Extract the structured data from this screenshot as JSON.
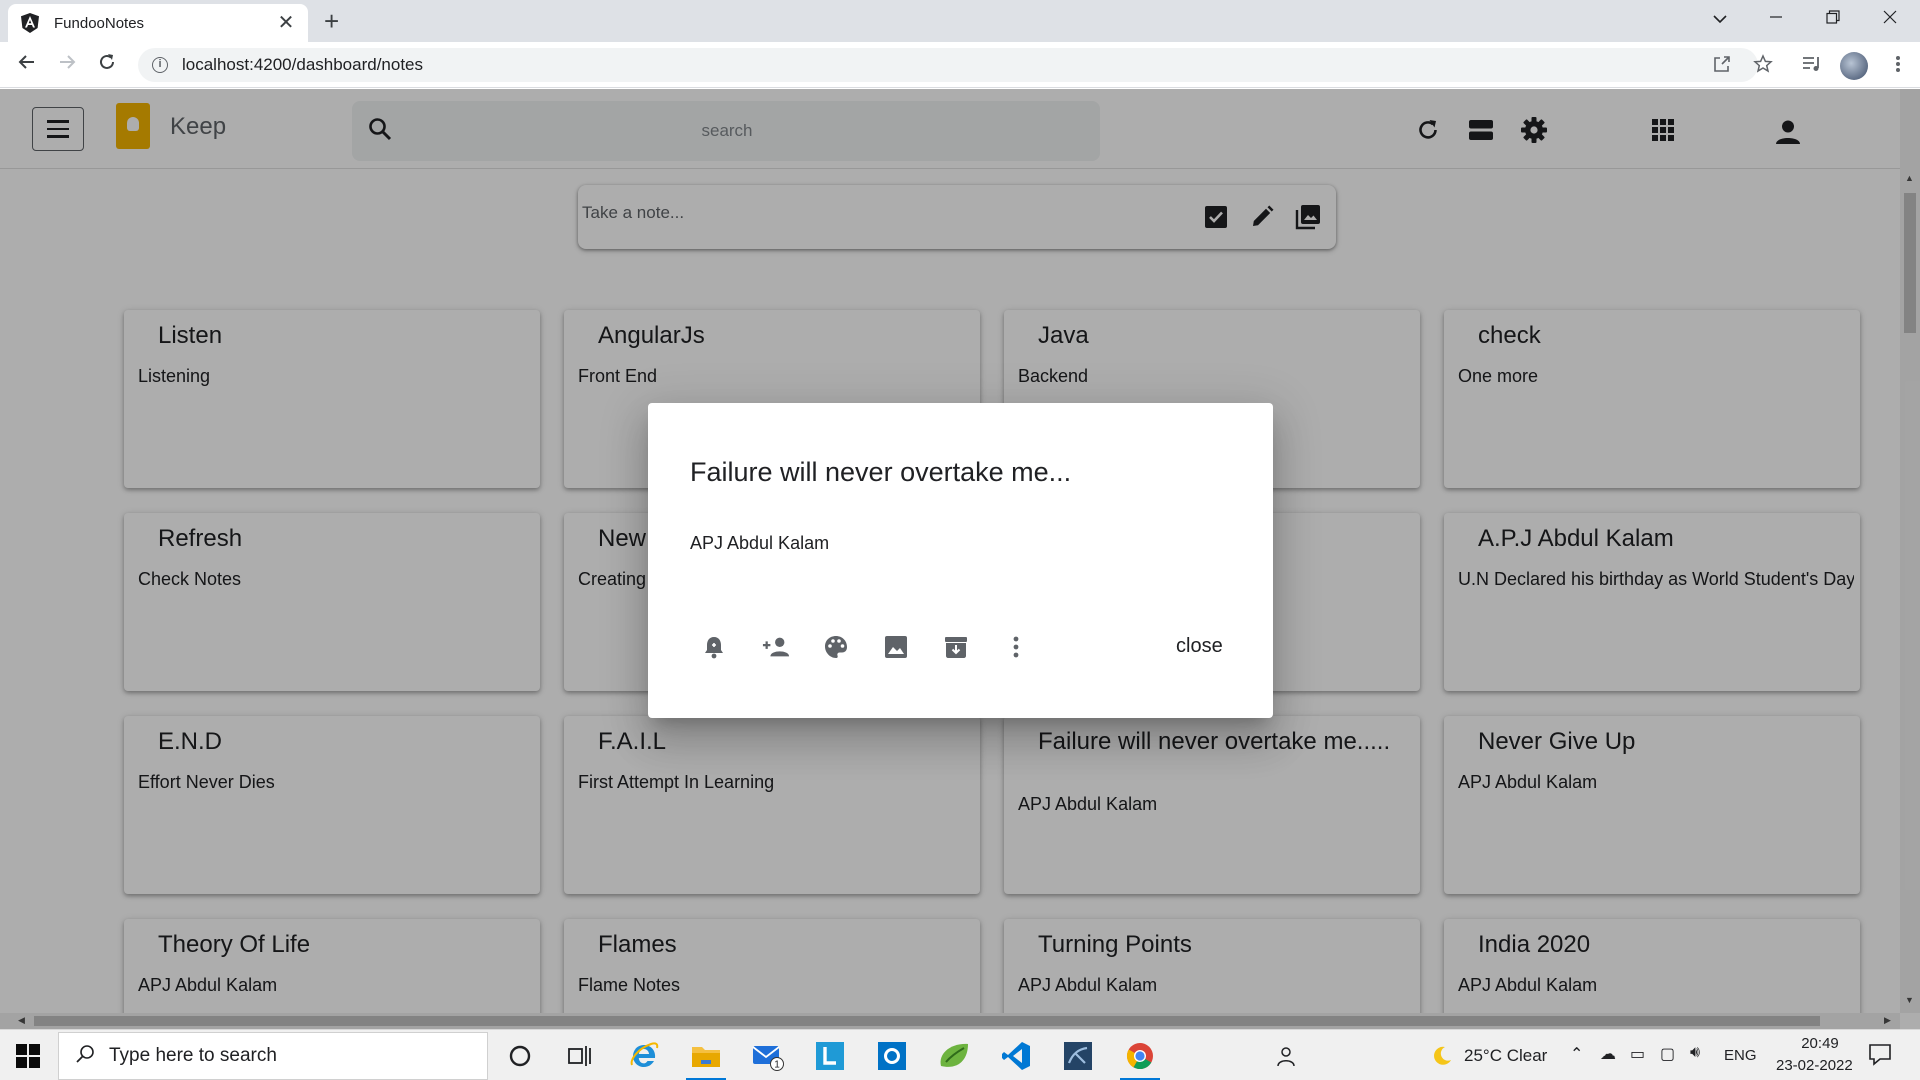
{
  "browser": {
    "tab_title": "FundooNotes",
    "tab_close": "✕",
    "new_tab": "+",
    "url": "localhost:4200/dashboard/notes",
    "info": "i"
  },
  "app": {
    "title": "Keep",
    "search_placeholder": "search",
    "note_placeholder": "Take a note..."
  },
  "notes": [
    {
      "title": "Listen",
      "description": "Listening"
    },
    {
      "title": "AngularJs",
      "description": "Front End"
    },
    {
      "title": "Java",
      "description": "Backend"
    },
    {
      "title": "check",
      "description": "One more"
    },
    {
      "title": "Refresh",
      "description": "Check Notes"
    },
    {
      "title": "New",
      "description": "Creating"
    },
    {
      "title": "",
      "description": ""
    },
    {
      "title": "A.P.J Abdul Kalam",
      "description": "U.N Declared his birthday as World Student's Day."
    },
    {
      "title": "E.N.D",
      "description": "Effort Never Dies"
    },
    {
      "title": "F.A.I.L",
      "description": "First Attempt In Learning"
    },
    {
      "title": "Failure will never overtake me.....",
      "description": "APJ Abdul Kalam"
    },
    {
      "title": "Never Give Up",
      "description": "APJ Abdul Kalam"
    },
    {
      "title": "Theory Of Life",
      "description": "APJ Abdul Kalam"
    },
    {
      "title": "Flames",
      "description": "Flame Notes"
    },
    {
      "title": "Turning Points",
      "description": "APJ Abdul Kalam"
    },
    {
      "title": "India 2020",
      "description": "APJ Abdul Kalam"
    }
  ],
  "dialog": {
    "title": "Failure will never overtake me...",
    "description": "APJ Abdul Kalam",
    "close_label": "close"
  },
  "taskbar": {
    "search_placeholder": "Type here to search",
    "mail_badge": "1",
    "weather": "25°C  Clear",
    "language": "ENG",
    "time": "20:49",
    "date": "23-02-2022"
  },
  "colors": {
    "keep_yellow": "#f4b400",
    "backdrop": "rgba(0,0,0,0.32)",
    "taskbar_active": "#0078d7"
  }
}
